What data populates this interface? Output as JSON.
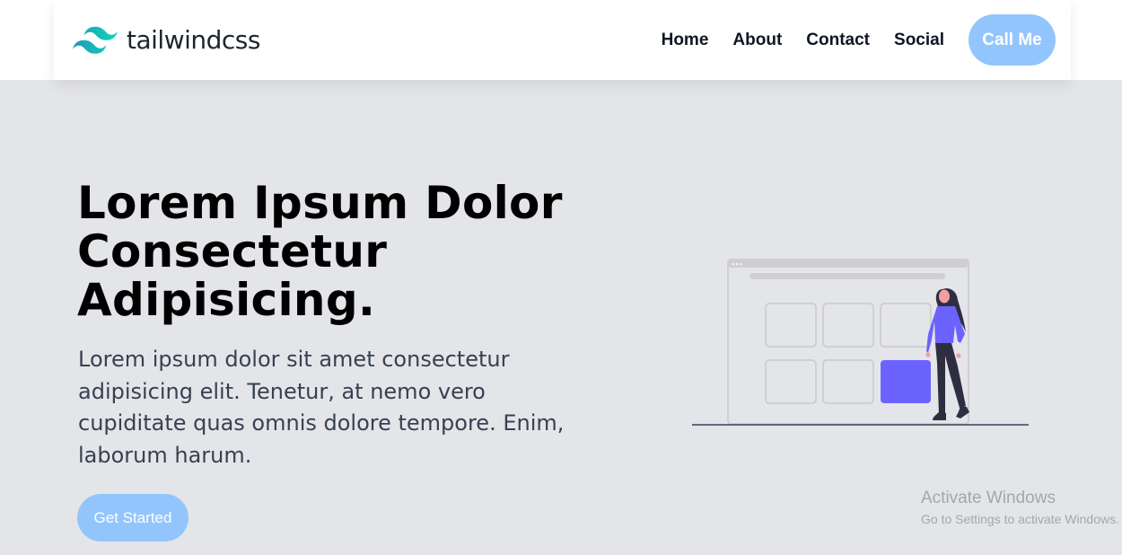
{
  "nav": {
    "brand": "tailwindcss",
    "links": [
      "Home",
      "About",
      "Contact",
      "Social"
    ],
    "call_label": "Call Me"
  },
  "hero": {
    "heading_lines": [
      "Lorem Ipsum Dolor",
      "Consectetur",
      "Adipisicing."
    ],
    "paragraph": "Lorem ipsum dolor sit amet consectetur adipisicing elit. Tenetur, at nemo vero cupiditate quas omnis dolore tempore. Enim, laborum harum.",
    "cta_label": "Get Started"
  },
  "watermark": {
    "title": "Activate Windows",
    "subtitle": "Go to Settings to activate Windows."
  },
  "colors": {
    "accent": "#93c5fd",
    "hero_bg": "#e4e5e9",
    "illustration_purple": "#6c63ff",
    "logo_teal": "#38bdf8"
  },
  "icons": {
    "logo": "tailwind-wave-icon",
    "illustration": "woman-with-grid-illustration"
  }
}
